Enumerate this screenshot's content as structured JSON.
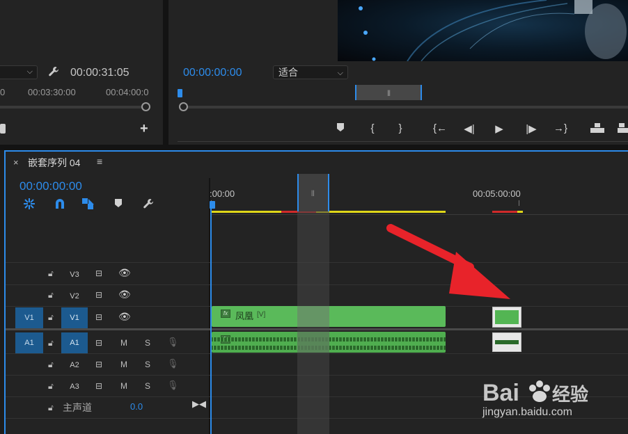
{
  "source_monitor": {
    "timecode": "00:00:31:05",
    "ruler_ticks": [
      "0",
      "00:03:30:00",
      "00:04:00:0"
    ],
    "icons": {
      "wrench": "wrench-icon",
      "camera": "camera-icon",
      "add": "plus-icon"
    }
  },
  "program_monitor": {
    "timecode": "00:00:00:00",
    "fit_select": {
      "value": "适合"
    },
    "transport_icons": [
      "marker-icon",
      "mark-in-icon",
      "mark-out-icon",
      "go-to-in-icon",
      "step-back-icon",
      "play-icon",
      "step-forward-icon",
      "go-to-out-icon",
      "lift-icon",
      "extract-icon"
    ]
  },
  "timeline": {
    "sequence_name": "嵌套序列 04",
    "close": "×",
    "menu": "≡",
    "timecode": "00:00:00:00",
    "ruler_labels": [
      ":00:00",
      "00:05:00:00"
    ],
    "tools": [
      "nest-icon",
      "snap-icon",
      "linked-selection-icon",
      "add-marker-icon",
      "settings-wrench-icon"
    ],
    "tracks": {
      "video": [
        {
          "name": "V3",
          "target": "",
          "targeted": false
        },
        {
          "name": "V2",
          "target": "",
          "targeted": false
        },
        {
          "name": "V1",
          "target": "V1",
          "targeted": true
        }
      ],
      "audio": [
        {
          "name": "A1",
          "target": "A1",
          "targeted": true,
          "mute": "M",
          "solo": "S"
        },
        {
          "name": "A2",
          "target": "",
          "targeted": false,
          "mute": "M",
          "solo": "S"
        },
        {
          "name": "A3",
          "target": "",
          "targeted": false,
          "mute": "M",
          "solo": "S"
        }
      ],
      "master": {
        "label": "主声道",
        "value": "0.0"
      }
    },
    "clips": {
      "video_clip_label": "凤凰",
      "video_clip_tag": "[V]",
      "fx_badge": "fx"
    },
    "colors": {
      "accent": "#2d8ceb",
      "clip_green": "#5aba5a",
      "clip_highlight": "#8cf58c",
      "render_yellow": "#dfd618",
      "render_red": "#d02a2a",
      "annotation_arrow": "#e8232a"
    }
  },
  "watermark": {
    "brand": "Bai du 经验",
    "url": "jingyan.baidu.com"
  }
}
